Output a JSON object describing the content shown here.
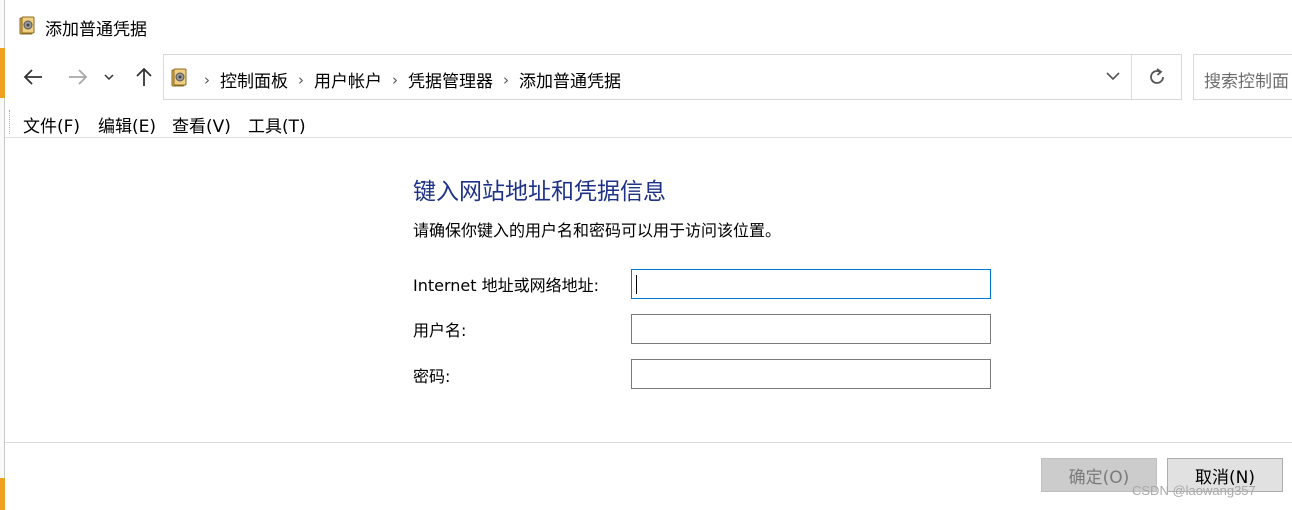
{
  "window": {
    "title": "添加普通凭据",
    "icon": "credential-manager-icon"
  },
  "nav": {
    "back_icon": "arrow-left-icon",
    "forward_icon": "arrow-right-icon",
    "recent_icon": "chevron-down-icon",
    "up_icon": "arrow-up-icon",
    "breadcrumbs": [
      "控制面板",
      "用户帐户",
      "凭据管理器",
      "添加普通凭据"
    ],
    "refresh_icon": "refresh-icon",
    "search_placeholder": "搜索控制面"
  },
  "menu": {
    "items": [
      "文件(F)",
      "编辑(E)",
      "查看(V)",
      "工具(T)"
    ]
  },
  "form": {
    "heading": "键入网站地址和凭据信息",
    "description": "请确保你键入的用户名和密码可以用于访问该位置。",
    "fields": [
      {
        "label": "Internet 地址或网络地址:",
        "value": ""
      },
      {
        "label": "用户名:",
        "value": ""
      },
      {
        "label": "密码:",
        "value": ""
      }
    ]
  },
  "buttons": {
    "ok": "确定(O)",
    "cancel": "取消(N)"
  },
  "watermark": "CSDN @laowang357",
  "colors": {
    "heading": "#1e3287",
    "focus_border": "#0078d7",
    "disabled_button": "#cccccc"
  }
}
